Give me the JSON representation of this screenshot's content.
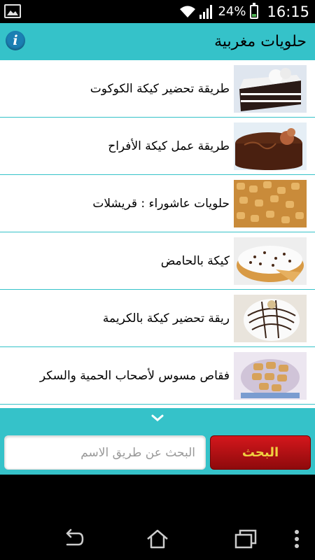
{
  "status": {
    "battery": "24%",
    "time": "16:15"
  },
  "app": {
    "title": "حلويات مغربية"
  },
  "recipes": [
    {
      "label": "طريقة تحضير كيكة الكوكوت"
    },
    {
      "label": "طريقة عمل كيكة الأفراح"
    },
    {
      "label": "حلويات عاشوراء : قريشلات"
    },
    {
      "label": "كيكة بالحامض"
    },
    {
      "label": "ريقة تحضير كيكة بالكريمة"
    },
    {
      "label": "فقاص مسوس لأصحاب الحمية والسكر"
    }
  ],
  "search": {
    "placeholder": "البحث عن طريق الاسم",
    "button_label": "البحث",
    "button_text_color": "#f0d040",
    "button_color": "#c0141a"
  },
  "colors": {
    "accent": "#35c2c9",
    "statusbar": "#000000"
  }
}
